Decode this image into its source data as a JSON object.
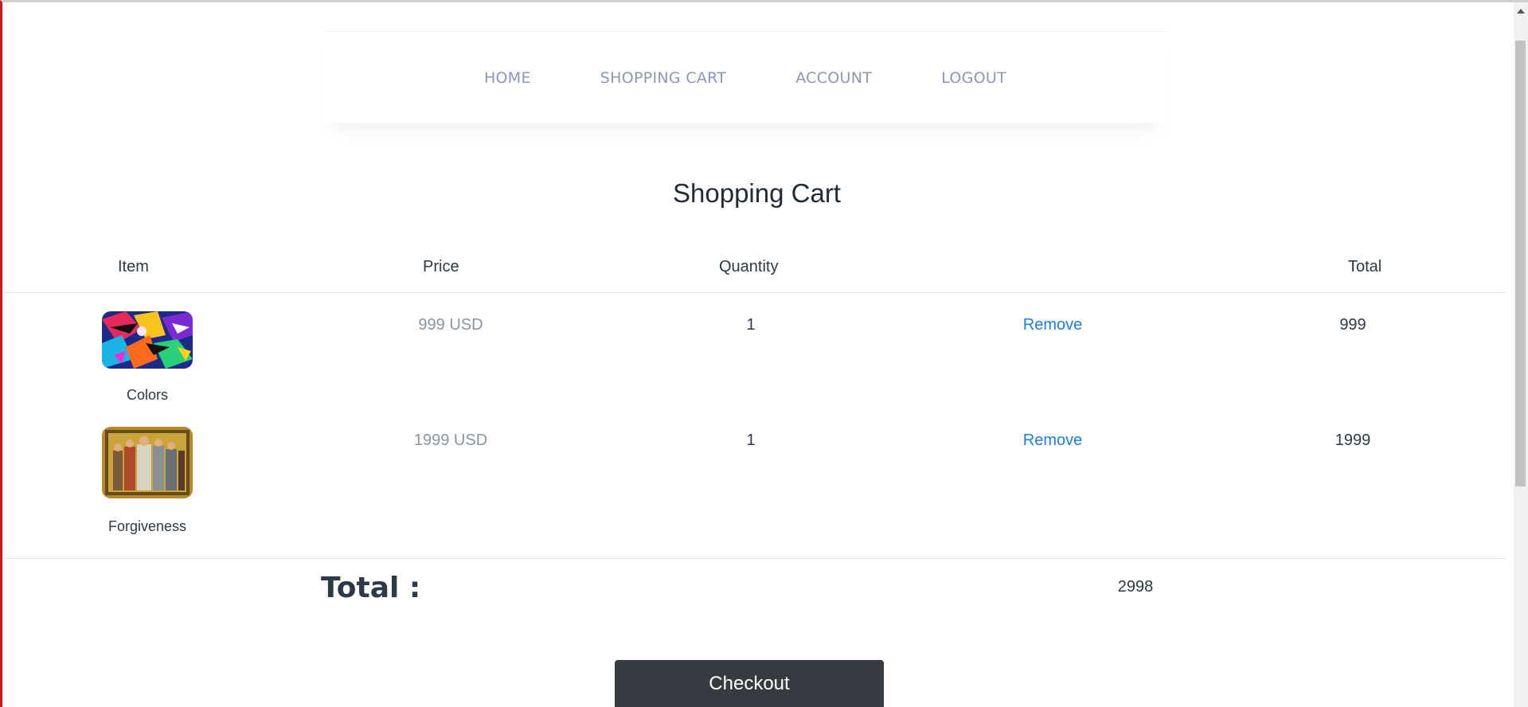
{
  "nav": {
    "items": [
      {
        "label": "HOME"
      },
      {
        "label": "SHOPPING CART"
      },
      {
        "label": "ACCOUNT"
      },
      {
        "label": "LOGOUT"
      }
    ]
  },
  "cart": {
    "title": "Shopping Cart",
    "columns": {
      "item": "Item",
      "price": "Price",
      "quantity": "Quantity",
      "total": "Total"
    },
    "rows": [
      {
        "image_icon": "abstract-colors-painting-thumbnail",
        "name": "Colors",
        "price": "999 USD",
        "quantity": "1",
        "remove_label": "Remove",
        "total": "999"
      },
      {
        "image_icon": "mosaic-forgiveness-thumbnail",
        "name": "Forgiveness",
        "price": "1999 USD",
        "quantity": "1",
        "remove_label": "Remove",
        "total": "1999"
      }
    ],
    "total_label": "Total :",
    "total_value": "2998",
    "checkout_label": "Checkout"
  },
  "colors": {
    "accent_link": "#1a7ee8",
    "nav_text": "#8c96b8",
    "checkout_bg": "#363a41",
    "window_edge": "#d6141e"
  }
}
